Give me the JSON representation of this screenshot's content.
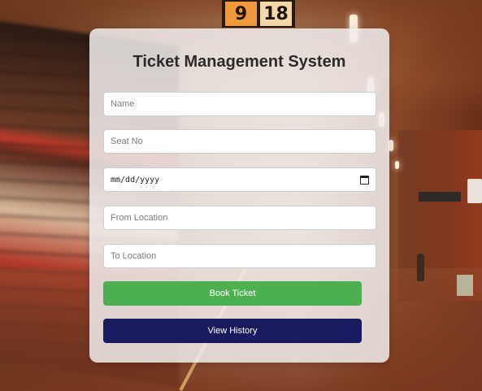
{
  "clock": {
    "digit_left": "9",
    "digit_right": "18"
  },
  "form": {
    "title": "Ticket Management System",
    "name_placeholder": "Name",
    "seat_placeholder": "Seat No",
    "date_placeholder": "mm/dd/yyyy",
    "from_placeholder": "From Location",
    "to_placeholder": "To Location",
    "book_label": "Book Ticket",
    "history_label": "View History",
    "icons": {
      "date_picker": "calendar-icon"
    }
  },
  "colors": {
    "book_button": "#4caf50",
    "history_button": "#1a1a5e"
  }
}
